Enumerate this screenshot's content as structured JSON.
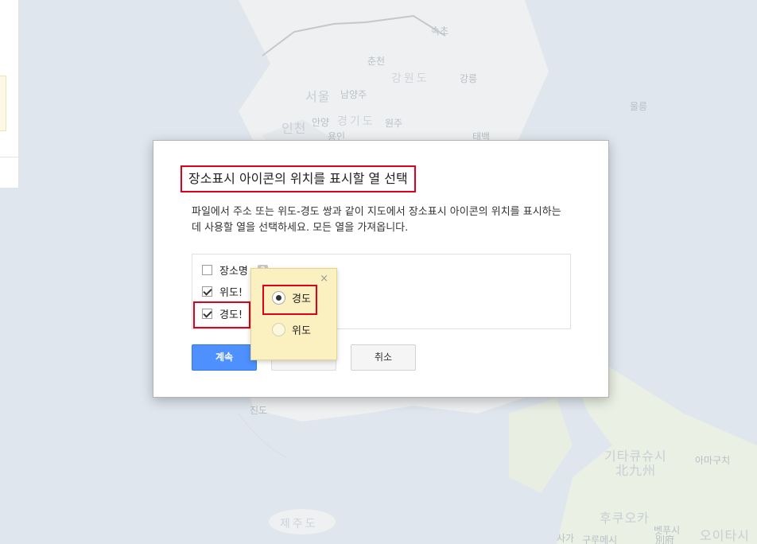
{
  "map": {
    "labels": {
      "sokcho": "속초",
      "chuncheon": "춘천",
      "gangwon": "강원도",
      "gangneung": "강릉",
      "ulleung": "울릉",
      "seoul": "서울",
      "namyangju": "남양주",
      "incheon": "인천",
      "anyang": "안양",
      "gyeonggi": "경기도",
      "wonju": "원주",
      "yongin": "용인",
      "taebaek": "태백",
      "jindo": "진도",
      "jeju": "제주도",
      "kitakyushu": "기타큐슈시",
      "kitakyushu_jp": "北九州",
      "fukuoka": "후쿠오카",
      "amagi": "아마구치",
      "beppu": "벳푸시",
      "beppu_jp": "別府",
      "oita": "오이타시",
      "saga": "사가",
      "kurume": "구루메시"
    }
  },
  "dialog": {
    "title": "장소표시 아이콘의 위치를 표시할 열 선택",
    "description": "파일에서 주소 또는 위도-경도 쌍과 같이 지도에서 장소표시 아이콘의 위치를 표시하는 데 사용할 열을 선택하세요. 모든 열을 가져옵니다.",
    "columns": [
      {
        "label": "장소명",
        "checked": false,
        "help": "?"
      },
      {
        "label": "위도!",
        "checked": true
      },
      {
        "label": "경도!",
        "checked": true
      }
    ],
    "continue_label": "계속",
    "cancel_label": "취소"
  },
  "popover": {
    "close": "×",
    "options": [
      {
        "label": "경도",
        "selected": true
      },
      {
        "label": "위도",
        "selected": false
      }
    ]
  },
  "colors": {
    "accent_blue": "#4d90fe",
    "highlight_red": "#e0001b",
    "popover_bg": "#fbf0c0"
  }
}
